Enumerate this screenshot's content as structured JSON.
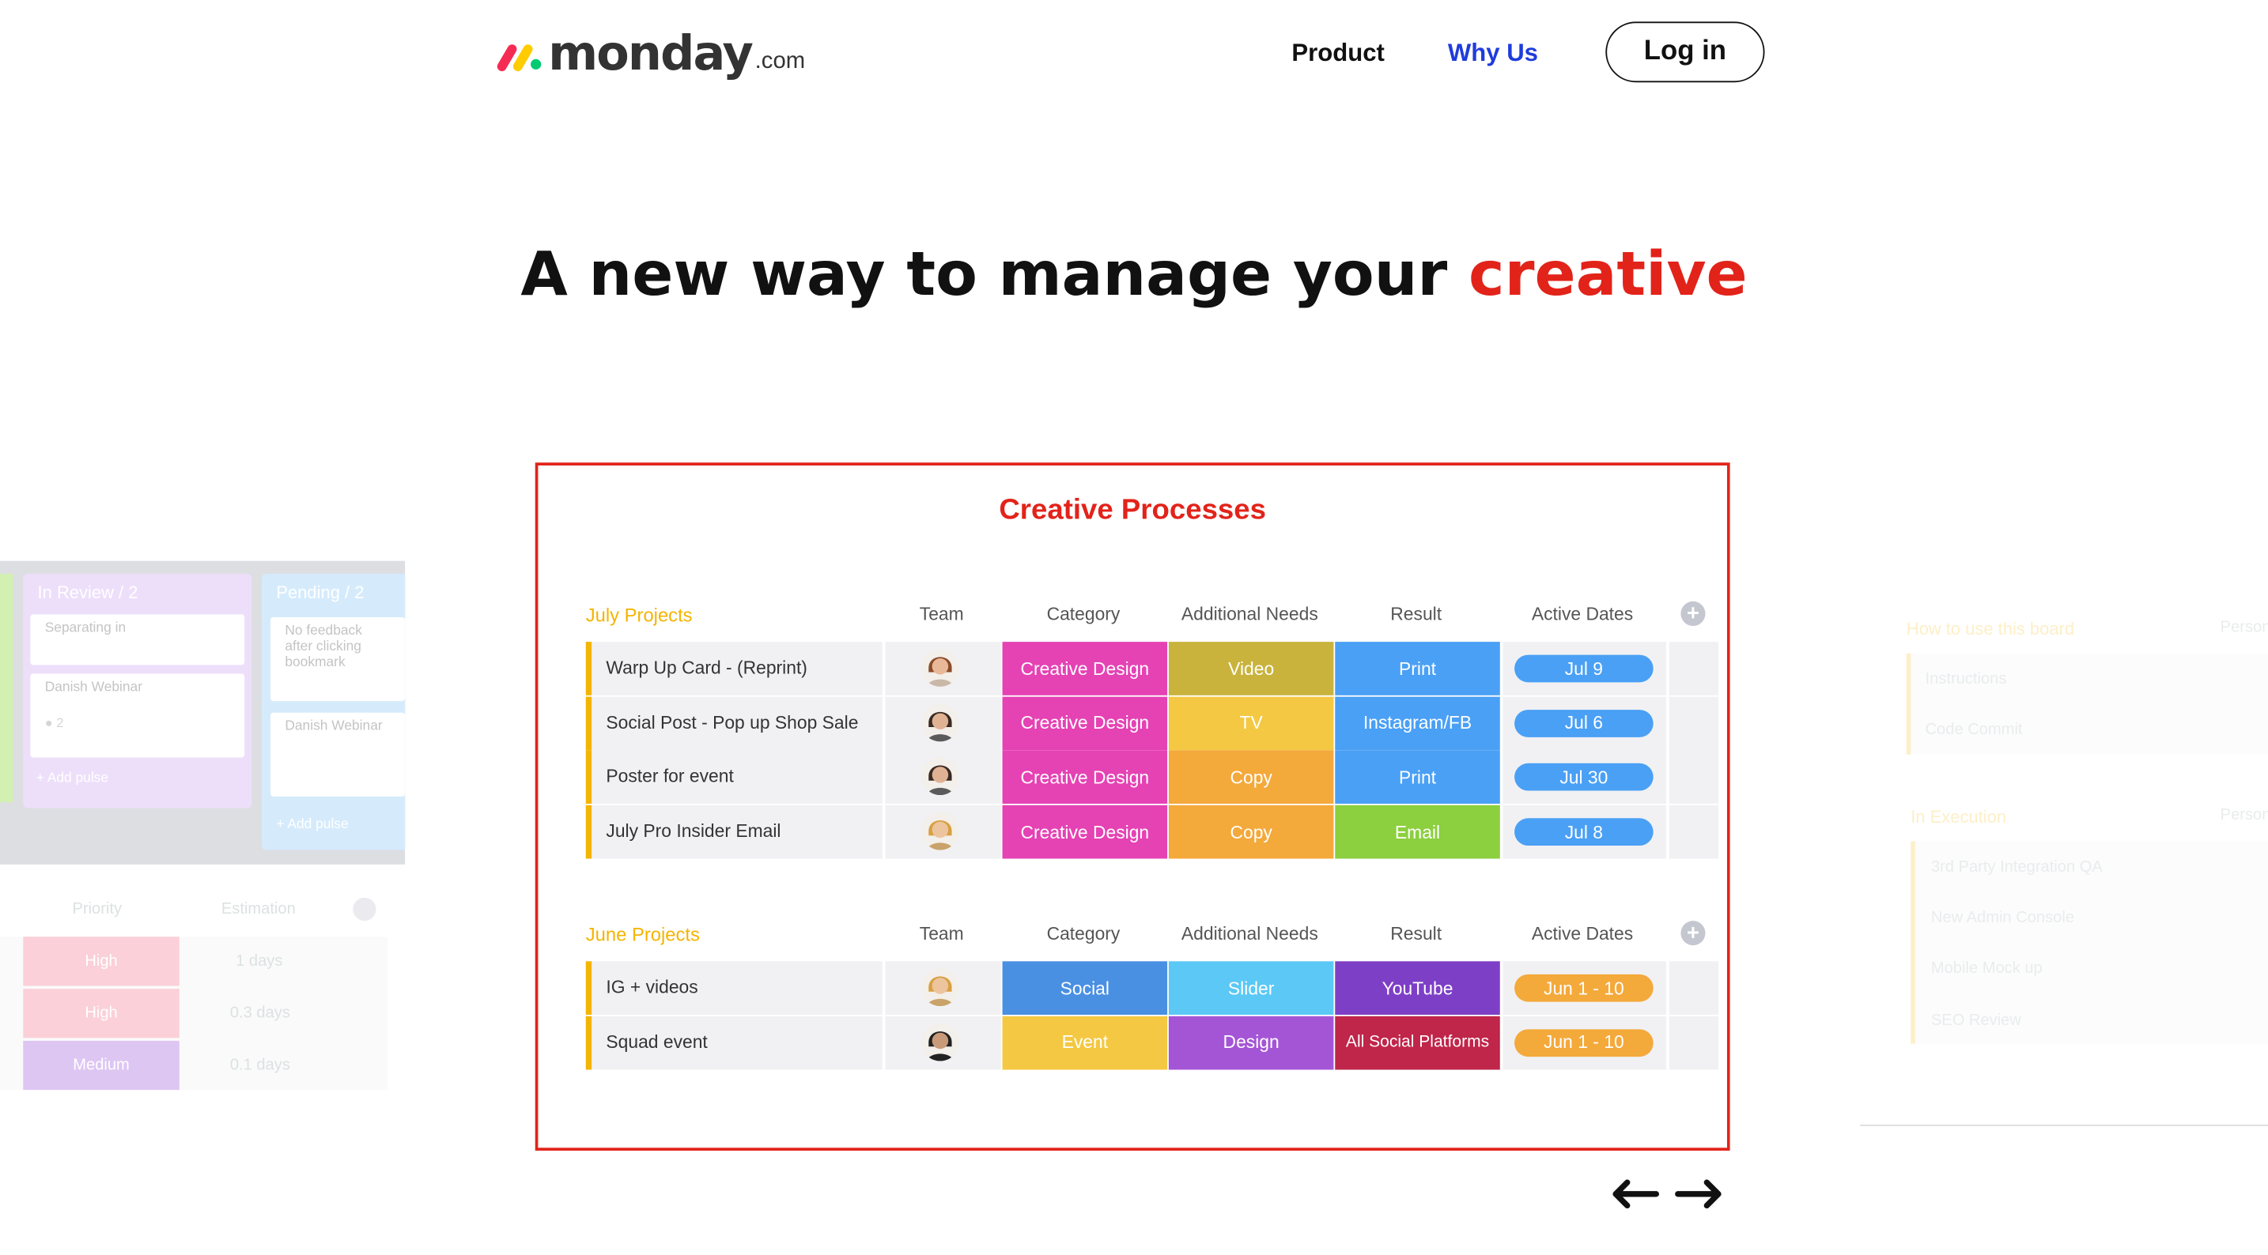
{
  "header": {
    "logo_word": "monday",
    "logo_domain": ".com",
    "nav": [
      {
        "label": "Product",
        "color": "#111111"
      },
      {
        "label": "Why Us",
        "color": "#1f3cdb"
      }
    ],
    "login_label": "Log in"
  },
  "hero": {
    "text": "A new way to manage your",
    "highlight": "creative",
    "highlight_color": "#e2231a"
  },
  "board": {
    "title": "Creative Processes",
    "columns": [
      "Team",
      "Category",
      "Additional Needs",
      "Result",
      "Active Dates"
    ],
    "groups": [
      {
        "title": "July Projects",
        "color": "#f5b400",
        "rows": [
          {
            "name": "Warp Up Card - (Reprint)",
            "category": {
              "label": "Creative Design",
              "color": "#e542b4"
            },
            "needs": {
              "label": "Video",
              "color": "#c9b33c"
            },
            "result": {
              "label": "Print",
              "color": "#4aa0f5"
            },
            "date": {
              "label": "Jul 9",
              "color": "#4aa0f5"
            },
            "avatar": "woman-avatar"
          },
          {
            "name": "Social Post - Pop up Shop Sale",
            "category": {
              "label": "Creative Design",
              "color": "#e542b4"
            },
            "needs": {
              "label": "TV",
              "color": "#f4c842"
            },
            "result": {
              "label": "Instagram/FB",
              "color": "#4aa0f5"
            },
            "date": {
              "label": "Jul 6",
              "color": "#4aa0f5"
            },
            "avatar": "man-glasses-avatar"
          },
          {
            "name": "Poster for event",
            "category": {
              "label": "Creative Design",
              "color": "#e542b4"
            },
            "needs": {
              "label": "Copy",
              "color": "#f4a93b"
            },
            "result": {
              "label": "Print",
              "color": "#4aa0f5"
            },
            "date": {
              "label": "Jul 30",
              "color": "#4aa0f5"
            },
            "avatar": "man-glasses-avatar"
          },
          {
            "name": "July Pro Insider Email",
            "category": {
              "label": "Creative Design",
              "color": "#e542b4"
            },
            "needs": {
              "label": "Copy",
              "color": "#f4a93b"
            },
            "result": {
              "label": "Email",
              "color": "#8ccf3f"
            },
            "date": {
              "label": "Jul 8",
              "color": "#4aa0f5"
            },
            "avatar": "hat-avatar"
          }
        ]
      },
      {
        "title": "June Projects",
        "color": "#f5b400",
        "rows": [
          {
            "name": "IG + videos",
            "category": {
              "label": "Social",
              "color": "#4a90e2"
            },
            "needs": {
              "label": "Slider",
              "color": "#5bc8f5"
            },
            "result": {
              "label": "YouTube",
              "color": "#7e3fc7"
            },
            "date": {
              "label": "Jun 1 - 10",
              "color": "#f4a93b"
            },
            "avatar": "hat-avatar"
          },
          {
            "name": "Squad event",
            "category": {
              "label": "Event",
              "color": "#f4c842"
            },
            "needs": {
              "label": "Design",
              "color": "#a455d6"
            },
            "result": {
              "label": "All Social Platforms",
              "color": "#c0254a"
            },
            "date": {
              "label": "Jun 1 - 10",
              "color": "#f4a93b"
            },
            "avatar": "bald-man-avatar"
          }
        ]
      }
    ]
  },
  "left_board": {
    "columns": [
      {
        "title": "In Review / 2",
        "color": "#caa3f1",
        "cards": [
          "Separating in",
          "Danish Webinar"
        ],
        "comment_count": "2",
        "add": "+ Add pulse"
      },
      {
        "title": "Pending / 2",
        "color": "#88c7f7",
        "cards": [
          "No feedback after clicking bookmark",
          "Danish Webinar"
        ],
        "add": "+ Add pulse"
      }
    ],
    "table_headers": [
      "Priority",
      "Estimation"
    ],
    "table_rows": [
      {
        "priority": "High",
        "color": "#f37a8f",
        "estimation": "1 days"
      },
      {
        "priority": "High",
        "color": "#f37a8f",
        "estimation": "0.3 days"
      },
      {
        "priority": "Medium",
        "color": "#a25ddc",
        "estimation": "0.1 days"
      }
    ]
  },
  "right_board": {
    "group1": {
      "title": "How to use this board",
      "person_header": "Person",
      "items": [
        "Instructions",
        "Code Commit"
      ]
    },
    "group2": {
      "title": "In Execution",
      "person_header": "Person",
      "items": [
        "3rd Party Integration QA",
        "New Admin Console",
        "Mobile Mock up",
        "SEO Review"
      ]
    }
  },
  "carousel": {
    "prev_icon": "arrow-left-icon",
    "next_icon": "arrow-right-icon"
  }
}
